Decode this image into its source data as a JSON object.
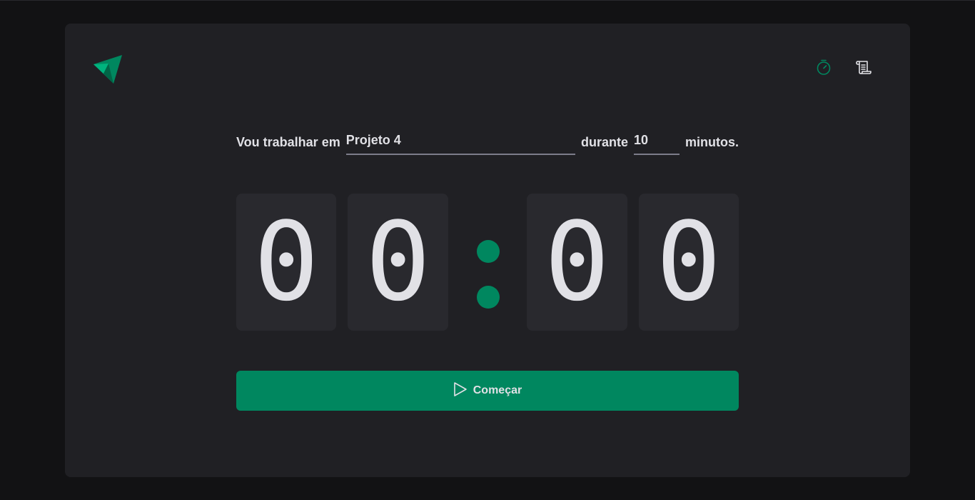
{
  "header": {
    "logo_icon": "triangle-logo-icon",
    "nav": [
      {
        "icon": "timer-icon",
        "active": true
      },
      {
        "icon": "scroll-icon",
        "active": false
      }
    ]
  },
  "form": {
    "task_label": "Vou trabalhar em",
    "task_value": "Projeto 4",
    "duration_label": "durante",
    "minutes_value": "10",
    "minutes_suffix": "minutos."
  },
  "countdown": {
    "minute_tens": "0",
    "minute_ones": "0",
    "second_tens": "0",
    "second_ones": "0"
  },
  "start_button": {
    "label": "Começar",
    "icon": "play-icon"
  },
  "colors": {
    "background": "#121214",
    "card": "#202024",
    "digit_bg": "#29292e",
    "accent": "#00875f",
    "text": "#e1e1e6",
    "input_border": "#7c7c8a"
  }
}
